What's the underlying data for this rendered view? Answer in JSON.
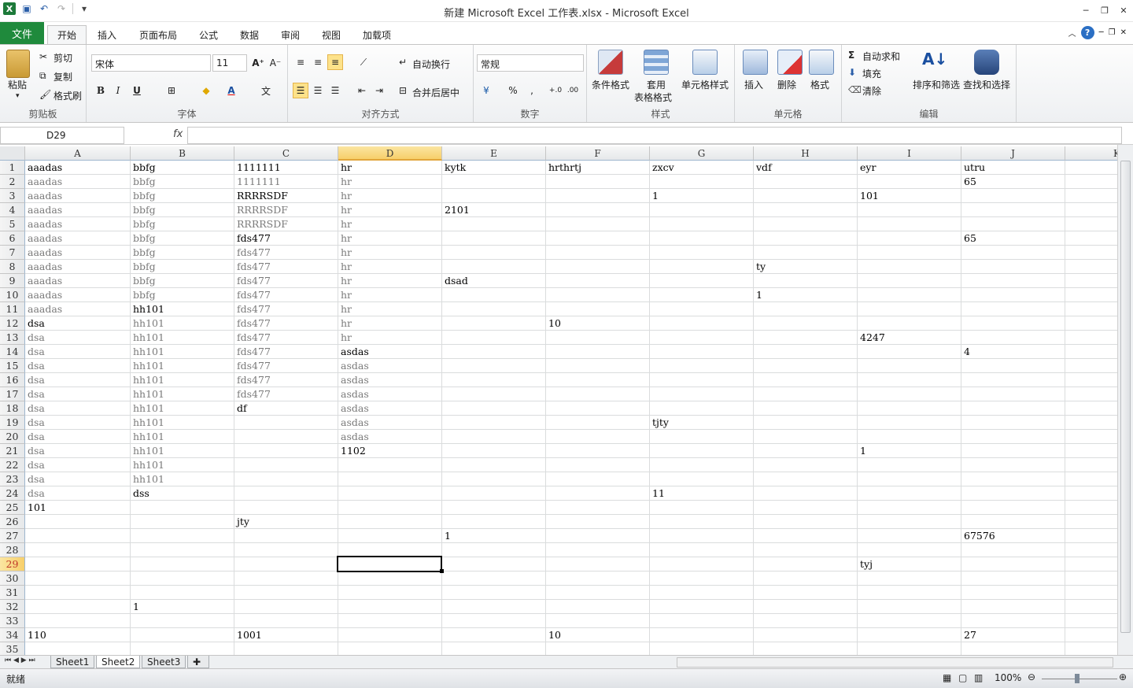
{
  "window": {
    "title": "新建 Microsoft Excel 工作表.xlsx  -  Microsoft Excel"
  },
  "tabs": [
    "文件",
    "开始",
    "插入",
    "页面布局",
    "公式",
    "数据",
    "审阅",
    "视图",
    "加载项"
  ],
  "ribbon": {
    "clipboard": {
      "paste": "粘贴",
      "cut": "剪切",
      "copy": "复制",
      "format_painter": "格式刷",
      "label": "剪贴板"
    },
    "font": {
      "name": "宋体",
      "size": "11",
      "label": "字体",
      "bold": "B",
      "italic": "I",
      "underline": "U"
    },
    "alignment": {
      "wrap": "自动换行",
      "merge": "合并后居中",
      "label": "对齐方式"
    },
    "number": {
      "format": "常规",
      "label": "数字"
    },
    "styles": {
      "conditional": "条件格式",
      "table_line1": "套用",
      "table_line2": "表格格式",
      "cell_styles": "单元格样式",
      "label": "样式"
    },
    "cells": {
      "insert": "插入",
      "delete": "删除",
      "format": "格式",
      "label": "单元格"
    },
    "editing": {
      "autosum": "自动求和",
      "fill": "填充",
      "clear": "清除",
      "sort": "排序和筛选",
      "find": "查找和选择",
      "label": "编辑"
    }
  },
  "formula_bar": {
    "name_box": "D29",
    "fx": "fx",
    "content": ""
  },
  "grid": {
    "columns": [
      "A",
      "B",
      "C",
      "D",
      "E",
      "F",
      "G",
      "H",
      "I",
      "J",
      "K"
    ],
    "rows": [
      "1",
      "2",
      "3",
      "4",
      "5",
      "6",
      "7",
      "8",
      "9",
      "10",
      "11",
      "12",
      "13",
      "14",
      "15",
      "16",
      "17",
      "18",
      "19",
      "20",
      "21",
      "22",
      "23",
      "24",
      "25",
      "26",
      "27",
      "28",
      "29",
      "30",
      "31",
      "32",
      "33",
      "34",
      "35"
    ],
    "active_cell": "D29",
    "cells": [
      {
        "r": 1,
        "c": 0,
        "v": "aaadas"
      },
      {
        "r": 1,
        "c": 1,
        "v": "bbfg"
      },
      {
        "r": 1,
        "c": 2,
        "v": "1111111"
      },
      {
        "r": 1,
        "c": 3,
        "v": "hr"
      },
      {
        "r": 1,
        "c": 4,
        "v": "kytk"
      },
      {
        "r": 1,
        "c": 5,
        "v": "hrthrtj"
      },
      {
        "r": 1,
        "c": 6,
        "v": "zxcv"
      },
      {
        "r": 1,
        "c": 7,
        "v": "vdf"
      },
      {
        "r": 1,
        "c": 8,
        "v": "eyr"
      },
      {
        "r": 1,
        "c": 9,
        "v": "utru"
      },
      {
        "r": 2,
        "c": 0,
        "v": "aaadas",
        "d": 1
      },
      {
        "r": 2,
        "c": 1,
        "v": "bbfg",
        "d": 1
      },
      {
        "r": 2,
        "c": 2,
        "v": "1111111",
        "d": 1
      },
      {
        "r": 2,
        "c": 3,
        "v": "hr",
        "d": 1
      },
      {
        "r": 2,
        "c": 9,
        "v": "65"
      },
      {
        "r": 3,
        "c": 0,
        "v": "aaadas",
        "d": 1
      },
      {
        "r": 3,
        "c": 1,
        "v": "bbfg",
        "d": 1
      },
      {
        "r": 3,
        "c": 2,
        "v": "RRRRSDF"
      },
      {
        "r": 3,
        "c": 3,
        "v": "hr",
        "d": 1
      },
      {
        "r": 3,
        "c": 6,
        "v": "1"
      },
      {
        "r": 3,
        "c": 8,
        "v": "101"
      },
      {
        "r": 4,
        "c": 0,
        "v": "aaadas",
        "d": 1
      },
      {
        "r": 4,
        "c": 1,
        "v": "bbfg",
        "d": 1
      },
      {
        "r": 4,
        "c": 2,
        "v": "RRRRSDF",
        "d": 1
      },
      {
        "r": 4,
        "c": 3,
        "v": "hr",
        "d": 1
      },
      {
        "r": 4,
        "c": 4,
        "v": "2101"
      },
      {
        "r": 5,
        "c": 0,
        "v": "aaadas",
        "d": 1
      },
      {
        "r": 5,
        "c": 1,
        "v": "bbfg",
        "d": 1
      },
      {
        "r": 5,
        "c": 2,
        "v": "RRRRSDF",
        "d": 1
      },
      {
        "r": 5,
        "c": 3,
        "v": "hr",
        "d": 1
      },
      {
        "r": 6,
        "c": 0,
        "v": "aaadas",
        "d": 1
      },
      {
        "r": 6,
        "c": 1,
        "v": "bbfg",
        "d": 1
      },
      {
        "r": 6,
        "c": 2,
        "v": "fds477"
      },
      {
        "r": 6,
        "c": 3,
        "v": "hr",
        "d": 1
      },
      {
        "r": 6,
        "c": 9,
        "v": "65"
      },
      {
        "r": 7,
        "c": 0,
        "v": "aaadas",
        "d": 1
      },
      {
        "r": 7,
        "c": 1,
        "v": "bbfg",
        "d": 1
      },
      {
        "r": 7,
        "c": 2,
        "v": "fds477",
        "d": 1
      },
      {
        "r": 7,
        "c": 3,
        "v": "hr",
        "d": 1
      },
      {
        "r": 8,
        "c": 0,
        "v": "aaadas",
        "d": 1
      },
      {
        "r": 8,
        "c": 1,
        "v": "bbfg",
        "d": 1
      },
      {
        "r": 8,
        "c": 2,
        "v": "fds477",
        "d": 1
      },
      {
        "r": 8,
        "c": 3,
        "v": "hr",
        "d": 1
      },
      {
        "r": 8,
        "c": 7,
        "v": "ty"
      },
      {
        "r": 9,
        "c": 0,
        "v": "aaadas",
        "d": 1
      },
      {
        "r": 9,
        "c": 1,
        "v": "bbfg",
        "d": 1
      },
      {
        "r": 9,
        "c": 2,
        "v": "fds477",
        "d": 1
      },
      {
        "r": 9,
        "c": 3,
        "v": "hr",
        "d": 1
      },
      {
        "r": 9,
        "c": 4,
        "v": "dsad"
      },
      {
        "r": 10,
        "c": 0,
        "v": "aaadas",
        "d": 1
      },
      {
        "r": 10,
        "c": 1,
        "v": "bbfg",
        "d": 1
      },
      {
        "r": 10,
        "c": 2,
        "v": "fds477",
        "d": 1
      },
      {
        "r": 10,
        "c": 3,
        "v": "hr",
        "d": 1
      },
      {
        "r": 10,
        "c": 7,
        "v": "1"
      },
      {
        "r": 11,
        "c": 0,
        "v": "aaadas",
        "d": 1
      },
      {
        "r": 11,
        "c": 1,
        "v": "hh101"
      },
      {
        "r": 11,
        "c": 2,
        "v": "fds477",
        "d": 1
      },
      {
        "r": 11,
        "c": 3,
        "v": "hr",
        "d": 1
      },
      {
        "r": 12,
        "c": 0,
        "v": "dsa"
      },
      {
        "r": 12,
        "c": 1,
        "v": "hh101",
        "d": 1
      },
      {
        "r": 12,
        "c": 2,
        "v": "fds477",
        "d": 1
      },
      {
        "r": 12,
        "c": 3,
        "v": "hr",
        "d": 1
      },
      {
        "r": 12,
        "c": 5,
        "v": "10"
      },
      {
        "r": 13,
        "c": 0,
        "v": "dsa",
        "d": 1
      },
      {
        "r": 13,
        "c": 1,
        "v": "hh101",
        "d": 1
      },
      {
        "r": 13,
        "c": 2,
        "v": "fds477",
        "d": 1
      },
      {
        "r": 13,
        "c": 3,
        "v": "hr",
        "d": 1
      },
      {
        "r": 13,
        "c": 8,
        "v": "4247"
      },
      {
        "r": 14,
        "c": 0,
        "v": "dsa",
        "d": 1
      },
      {
        "r": 14,
        "c": 1,
        "v": "hh101",
        "d": 1
      },
      {
        "r": 14,
        "c": 2,
        "v": "fds477",
        "d": 1
      },
      {
        "r": 14,
        "c": 3,
        "v": "asdas"
      },
      {
        "r": 14,
        "c": 9,
        "v": "4"
      },
      {
        "r": 15,
        "c": 0,
        "v": "dsa",
        "d": 1
      },
      {
        "r": 15,
        "c": 1,
        "v": "hh101",
        "d": 1
      },
      {
        "r": 15,
        "c": 2,
        "v": "fds477",
        "d": 1
      },
      {
        "r": 15,
        "c": 3,
        "v": "asdas",
        "d": 1
      },
      {
        "r": 16,
        "c": 0,
        "v": "dsa",
        "d": 1
      },
      {
        "r": 16,
        "c": 1,
        "v": "hh101",
        "d": 1
      },
      {
        "r": 16,
        "c": 2,
        "v": "fds477",
        "d": 1
      },
      {
        "r": 16,
        "c": 3,
        "v": "asdas",
        "d": 1
      },
      {
        "r": 17,
        "c": 0,
        "v": "dsa",
        "d": 1
      },
      {
        "r": 17,
        "c": 1,
        "v": "hh101",
        "d": 1
      },
      {
        "r": 17,
        "c": 2,
        "v": "fds477",
        "d": 1
      },
      {
        "r": 17,
        "c": 3,
        "v": "asdas",
        "d": 1
      },
      {
        "r": 18,
        "c": 0,
        "v": "dsa",
        "d": 1
      },
      {
        "r": 18,
        "c": 1,
        "v": "hh101",
        "d": 1
      },
      {
        "r": 18,
        "c": 2,
        "v": "df"
      },
      {
        "r": 18,
        "c": 3,
        "v": "asdas",
        "d": 1
      },
      {
        "r": 19,
        "c": 0,
        "v": "dsa",
        "d": 1
      },
      {
        "r": 19,
        "c": 1,
        "v": "hh101",
        "d": 1
      },
      {
        "r": 19,
        "c": 3,
        "v": "asdas",
        "d": 1
      },
      {
        "r": 19,
        "c": 6,
        "v": "tjty"
      },
      {
        "r": 20,
        "c": 0,
        "v": "dsa",
        "d": 1
      },
      {
        "r": 20,
        "c": 1,
        "v": "hh101",
        "d": 1
      },
      {
        "r": 20,
        "c": 3,
        "v": "asdas",
        "d": 1
      },
      {
        "r": 21,
        "c": 0,
        "v": "dsa",
        "d": 1
      },
      {
        "r": 21,
        "c": 1,
        "v": "hh101",
        "d": 1
      },
      {
        "r": 21,
        "c": 3,
        "v": "1102"
      },
      {
        "r": 21,
        "c": 8,
        "v": "1"
      },
      {
        "r": 22,
        "c": 0,
        "v": "dsa",
        "d": 1
      },
      {
        "r": 22,
        "c": 1,
        "v": "hh101",
        "d": 1
      },
      {
        "r": 23,
        "c": 0,
        "v": "dsa",
        "d": 1
      },
      {
        "r": 23,
        "c": 1,
        "v": "hh101",
        "d": 1
      },
      {
        "r": 24,
        "c": 0,
        "v": "dsa",
        "d": 1
      },
      {
        "r": 24,
        "c": 1,
        "v": "dss"
      },
      {
        "r": 24,
        "c": 6,
        "v": "11"
      },
      {
        "r": 25,
        "c": 0,
        "v": "101"
      },
      {
        "r": 26,
        "c": 2,
        "v": "jty"
      },
      {
        "r": 27,
        "c": 4,
        "v": "1"
      },
      {
        "r": 27,
        "c": 9,
        "v": "67576"
      },
      {
        "r": 29,
        "c": 8,
        "v": "tyj"
      },
      {
        "r": 32,
        "c": 1,
        "v": "1"
      },
      {
        "r": 34,
        "c": 0,
        "v": "110"
      },
      {
        "r": 34,
        "c": 2,
        "v": "1001"
      },
      {
        "r": 34,
        "c": 5,
        "v": "10"
      },
      {
        "r": 34,
        "c": 9,
        "v": "27"
      }
    ]
  },
  "sheets": [
    "Sheet1",
    "Sheet2",
    "Sheet3"
  ],
  "active_sheet": "Sheet2",
  "status": {
    "ready": "就绪",
    "zoom": "100%"
  }
}
